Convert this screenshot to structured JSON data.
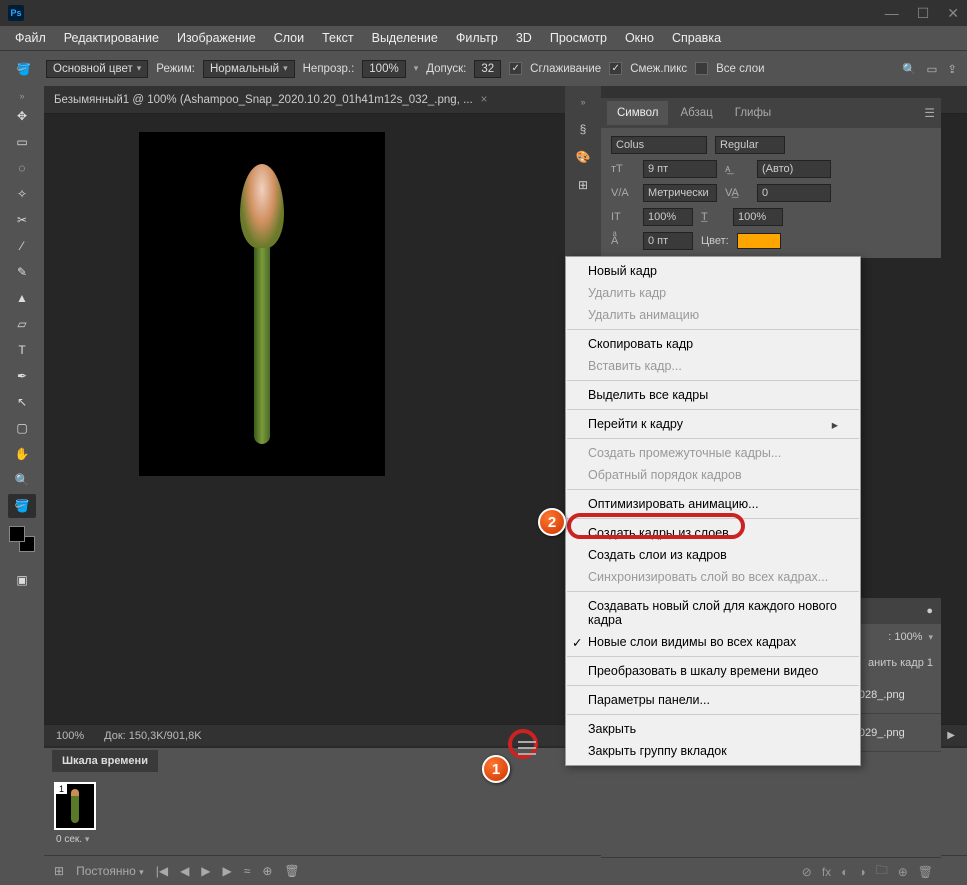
{
  "menubar": [
    "Файл",
    "Редактирование",
    "Изображение",
    "Слои",
    "Текст",
    "Выделение",
    "Фильтр",
    "3D",
    "Просмотр",
    "Окно",
    "Справка"
  ],
  "optionsbar": {
    "fill_label": "Основной цвет",
    "mode_label": "Режим:",
    "mode_value": "Нормальный",
    "opacity_label": "Непрозр.:",
    "opacity_value": "100%",
    "tolerance_label": "Допуск:",
    "tolerance_value": "32",
    "antialias": "Сглаживание",
    "contiguous": "Смеж.пикс",
    "all_layers": "Все слои"
  },
  "document_tab": "Безымянный1 @ 100% (Ashampoo_Snap_2020.10.20_01h41m12s_032_.png, ...",
  "status": {
    "zoom": "100%",
    "docinfo": "Док: 150,3K/901,8K"
  },
  "timeline": {
    "tab": "Шкала времени",
    "frame_num": "1",
    "frame_time": "0 сек.",
    "loop": "Постоянно"
  },
  "symbol_panel": {
    "tabs": [
      "Символ",
      "Абзац",
      "Глифы"
    ],
    "font": "Colus",
    "weight": "Regular",
    "size": "9 пт",
    "leading": "(Авто)",
    "kerning": "Метрически",
    "tracking": "0",
    "vscale": "100%",
    "hscale": "100%",
    "baseline": "0 пт",
    "color_label": "Цвет:",
    "color": "#ffa500"
  },
  "context_menu": {
    "items": [
      {
        "label": "Новый кадр",
        "disabled": false
      },
      {
        "label": "Удалить кадр",
        "disabled": true
      },
      {
        "label": "Удалить анимацию",
        "disabled": true
      },
      {
        "sep": true
      },
      {
        "label": "Скопировать кадр",
        "disabled": false
      },
      {
        "label": "Вставить кадр...",
        "disabled": true
      },
      {
        "sep": true
      },
      {
        "label": "Выделить все кадры",
        "disabled": false
      },
      {
        "sep": true
      },
      {
        "label": "Перейти к кадру",
        "disabled": false,
        "arrow": true
      },
      {
        "sep": true
      },
      {
        "label": "Создать промежуточные кадры...",
        "disabled": true
      },
      {
        "label": "Обратный порядок кадров",
        "disabled": true
      },
      {
        "sep": true
      },
      {
        "label": "Оптимизировать анимацию...",
        "disabled": false
      },
      {
        "sep": true
      },
      {
        "label": "Создать кадры из слоев",
        "disabled": false,
        "highlight": true
      },
      {
        "label": "Создать слои из кадров",
        "disabled": false
      },
      {
        "label": "Синхронизировать слой во всех кадрах...",
        "disabled": true
      },
      {
        "sep": true
      },
      {
        "label": "Создавать новый слой для каждого нового кадра",
        "disabled": false
      },
      {
        "label": "Новые слои видимы во всех кадрах",
        "disabled": false,
        "check": true
      },
      {
        "sep": true
      },
      {
        "label": "Преобразовать в шкалу времени видео",
        "disabled": false
      },
      {
        "sep": true
      },
      {
        "label": "Параметры панели...",
        "disabled": false
      },
      {
        "sep": true
      },
      {
        "label": "Закрыть",
        "disabled": false
      },
      {
        "label": "Закрыть группу вкладок",
        "disabled": false
      }
    ]
  },
  "layers_panel": {
    "opacity_label": "100%",
    "fill_label": "100%",
    "prop_text": "анить кадр 1",
    "rows": [
      {
        "name": "Ashampoo_Snap_2020..._01h40m41s_028_.png"
      },
      {
        "name": "Ashampoo_Snap_2020..._01h40m51s_029_.png"
      }
    ]
  },
  "badges": {
    "one": "1",
    "two": "2"
  }
}
